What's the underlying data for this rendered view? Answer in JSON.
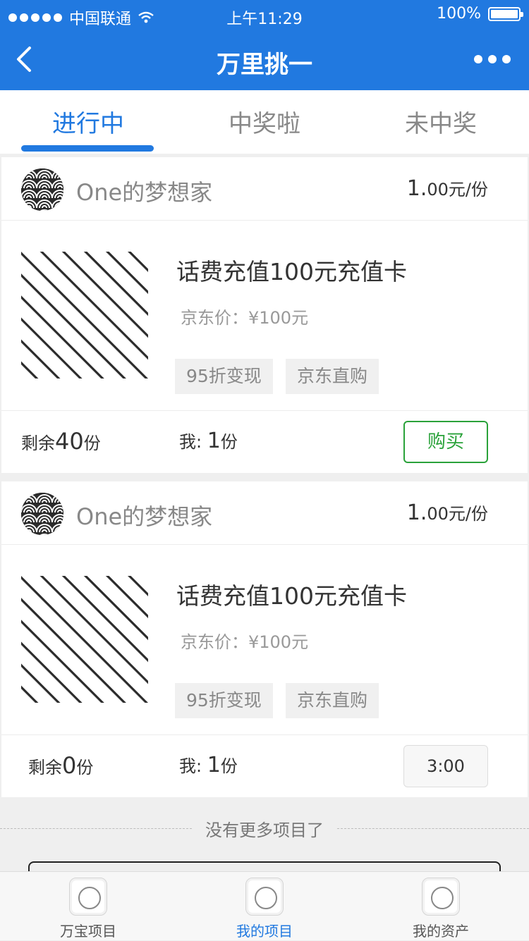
{
  "status_bar": {
    "carrier": "中国联通",
    "time": "上午11:29",
    "battery": "100%"
  },
  "nav": {
    "title": "万里挑一"
  },
  "tabs": [
    {
      "label": "进行中",
      "active": true
    },
    {
      "label": "中奖啦",
      "active": false
    },
    {
      "label": "未中奖",
      "active": false
    }
  ],
  "cards": [
    {
      "shop_name": "One的梦想家",
      "price_int": "1.",
      "price_rest": "00元/份",
      "product_title": "话费充值100元充值卡",
      "jd_price": "京东价：¥100元",
      "tags": [
        "95折变现",
        "京东直购"
      ],
      "remain_prefix": "剩余",
      "remain_count": "40",
      "remain_suffix": "份",
      "mine_prefix": "我: ",
      "mine_count": "1",
      "mine_suffix": "份",
      "action_label": "购买"
    },
    {
      "shop_name": "One的梦想家",
      "price_int": "1.",
      "price_rest": "00元/份",
      "product_title": "话费充值100元充值卡",
      "jd_price": "京东价：¥100元",
      "tags": [
        "95折变现",
        "京东直购"
      ],
      "remain_prefix": "剩余",
      "remain_count": "0",
      "remain_suffix": "份",
      "mine_prefix": "我: ",
      "mine_count": "1",
      "mine_suffix": "份",
      "action_label": "3:00"
    }
  ],
  "list_end": "没有更多项目了",
  "tabbar": [
    {
      "label": "万宝项目",
      "icon": "app-icon",
      "active": false
    },
    {
      "label": "我的项目",
      "icon": "app-icon",
      "active": true
    },
    {
      "label": "我的资产",
      "icon": "app-icon",
      "active": false
    }
  ],
  "colors": {
    "brand": "#2179e0",
    "buy": "#2aa23a"
  }
}
